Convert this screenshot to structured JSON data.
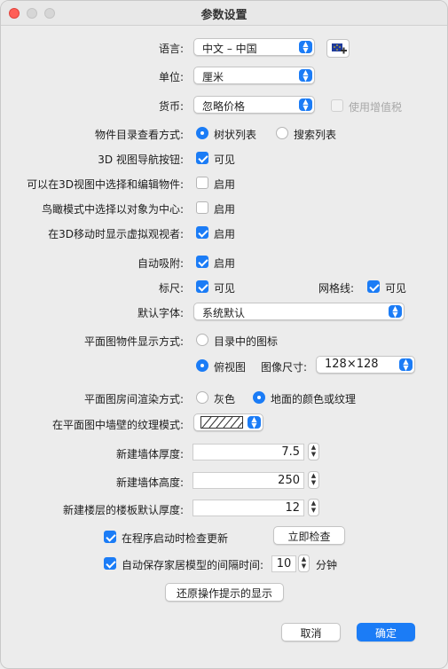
{
  "window": {
    "title": "参数设置"
  },
  "language": {
    "label": "语言:",
    "value": "中文 – 中国",
    "add_icon": "eu-flag-plus-icon"
  },
  "unit": {
    "label": "单位:",
    "value": "厘米"
  },
  "currency": {
    "label": "货币:",
    "value": "忽略价格",
    "vat_label": "使用增值税"
  },
  "catalog_view": {
    "label": "物件目录查看方式:",
    "option_tree": "树状列表",
    "option_search": "搜索列表"
  },
  "nav_arrows": {
    "label": "3D 视图导航按钮:",
    "option": "可见"
  },
  "edit_in_3d": {
    "label": "可以在3D视图中选择和编辑物件:",
    "option": "启用"
  },
  "aerial_center": {
    "label": "鸟瞰模式中选择以对象为中心:",
    "option": "启用"
  },
  "virtual_visitor": {
    "label": "在3D移动时显示虚拟观视者:",
    "option": "启用"
  },
  "magnetism": {
    "label": "自动吸附:",
    "option": "启用"
  },
  "rulers": {
    "label": "标尺:",
    "option": "可见",
    "grid_label": "网格线:",
    "grid_option": "可见"
  },
  "default_font": {
    "label": "默认字体:",
    "value": "系统默认"
  },
  "plan_icons": {
    "label": "平面图物件显示方式:",
    "option_catalog": "目录中的图标",
    "option_top": "俯视图",
    "size_label": "图像尺寸:",
    "size_value": "128×128"
  },
  "room_render": {
    "label": "平面图房间渲染方式:",
    "option_gray": "灰色",
    "option_floor": "地面的颜色或纹理"
  },
  "wall_pattern": {
    "label": "在平面图中墙壁的纹理模式:"
  },
  "wall_thickness": {
    "label": "新建墙体厚度:",
    "value": "7.5"
  },
  "wall_height": {
    "label": "新建墙体高度:",
    "value": "250"
  },
  "floor_thickness": {
    "label": "新建楼层的楼板默认厚度:",
    "value": "12"
  },
  "updates": {
    "label": "在程序启动时检查更新",
    "button": "立即检查"
  },
  "autosave": {
    "label": "自动保存家居模型的间隔时间:",
    "value": "10",
    "unit": "分钟"
  },
  "reset_tips": {
    "button": "还原操作提示的显示"
  },
  "footer": {
    "cancel": "取消",
    "ok": "确定"
  },
  "colors": {
    "accent": "#1b7cf6",
    "close": "#ff5f57"
  }
}
